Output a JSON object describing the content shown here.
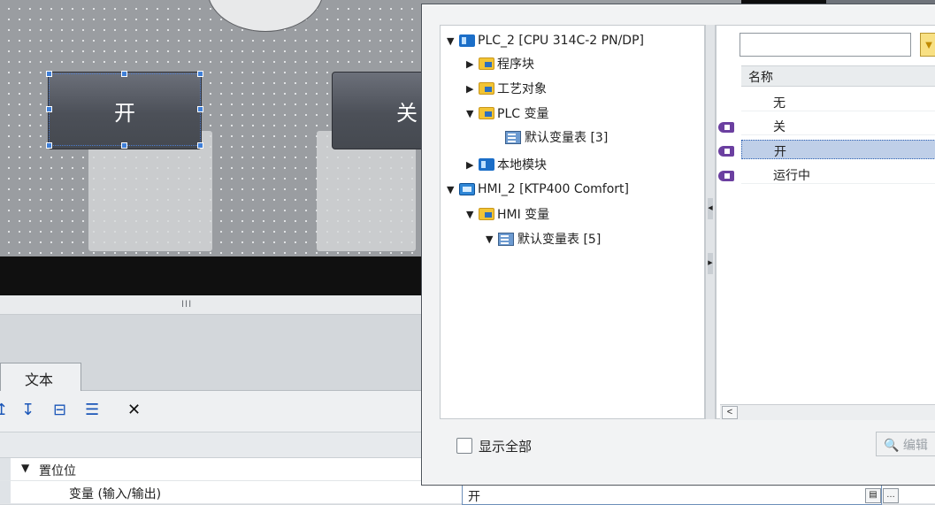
{
  "canvas": {
    "button_on_label": "开",
    "button_off_label": "关",
    "scroll_grip": "III"
  },
  "inspector": {
    "tab_text": "文本",
    "tree_group": "置位位",
    "property_label": "变量 (输入/输出)",
    "property_value": "开"
  },
  "popup": {
    "tree": [
      {
        "label": "PLC_2 [CPU 314C-2 PN/DP]",
        "icon": "plc-icon",
        "expand": "▼"
      },
      {
        "label": "程序块",
        "icon": "program-blocks-icon",
        "expand": "▶"
      },
      {
        "label": "工艺对象",
        "icon": "technology-objects-icon",
        "expand": "▶"
      },
      {
        "label": "PLC 变量",
        "icon": "folder-icon",
        "expand": "▼"
      },
      {
        "label": "默认变量表 [3]",
        "icon": "tag-table-icon",
        "expand": ""
      },
      {
        "label": "本地模块",
        "icon": "local-modules-icon",
        "expand": "▶"
      },
      {
        "label": "HMI_2 [KTP400 Comfort]",
        "icon": "hmi-icon",
        "expand": "▼"
      },
      {
        "label": "HMI 变量",
        "icon": "folder-icon",
        "expand": "▼"
      },
      {
        "label": "默认变量表 [5]",
        "icon": "tag-table-icon",
        "expand": "▼"
      }
    ],
    "list_header": "名称",
    "list_items": [
      {
        "name": "无",
        "icon": ""
      },
      {
        "name": "关",
        "icon": "tag-icon"
      },
      {
        "name": "开",
        "icon": "tag-icon",
        "selected": true
      },
      {
        "name": "运行中",
        "icon": "tag-icon"
      }
    ],
    "filter_placeholder": "",
    "show_all_label": "显示全部",
    "edit_label": "编辑",
    "filter_icon": "filter-icon",
    "selection_color": "#bfcfe8"
  }
}
